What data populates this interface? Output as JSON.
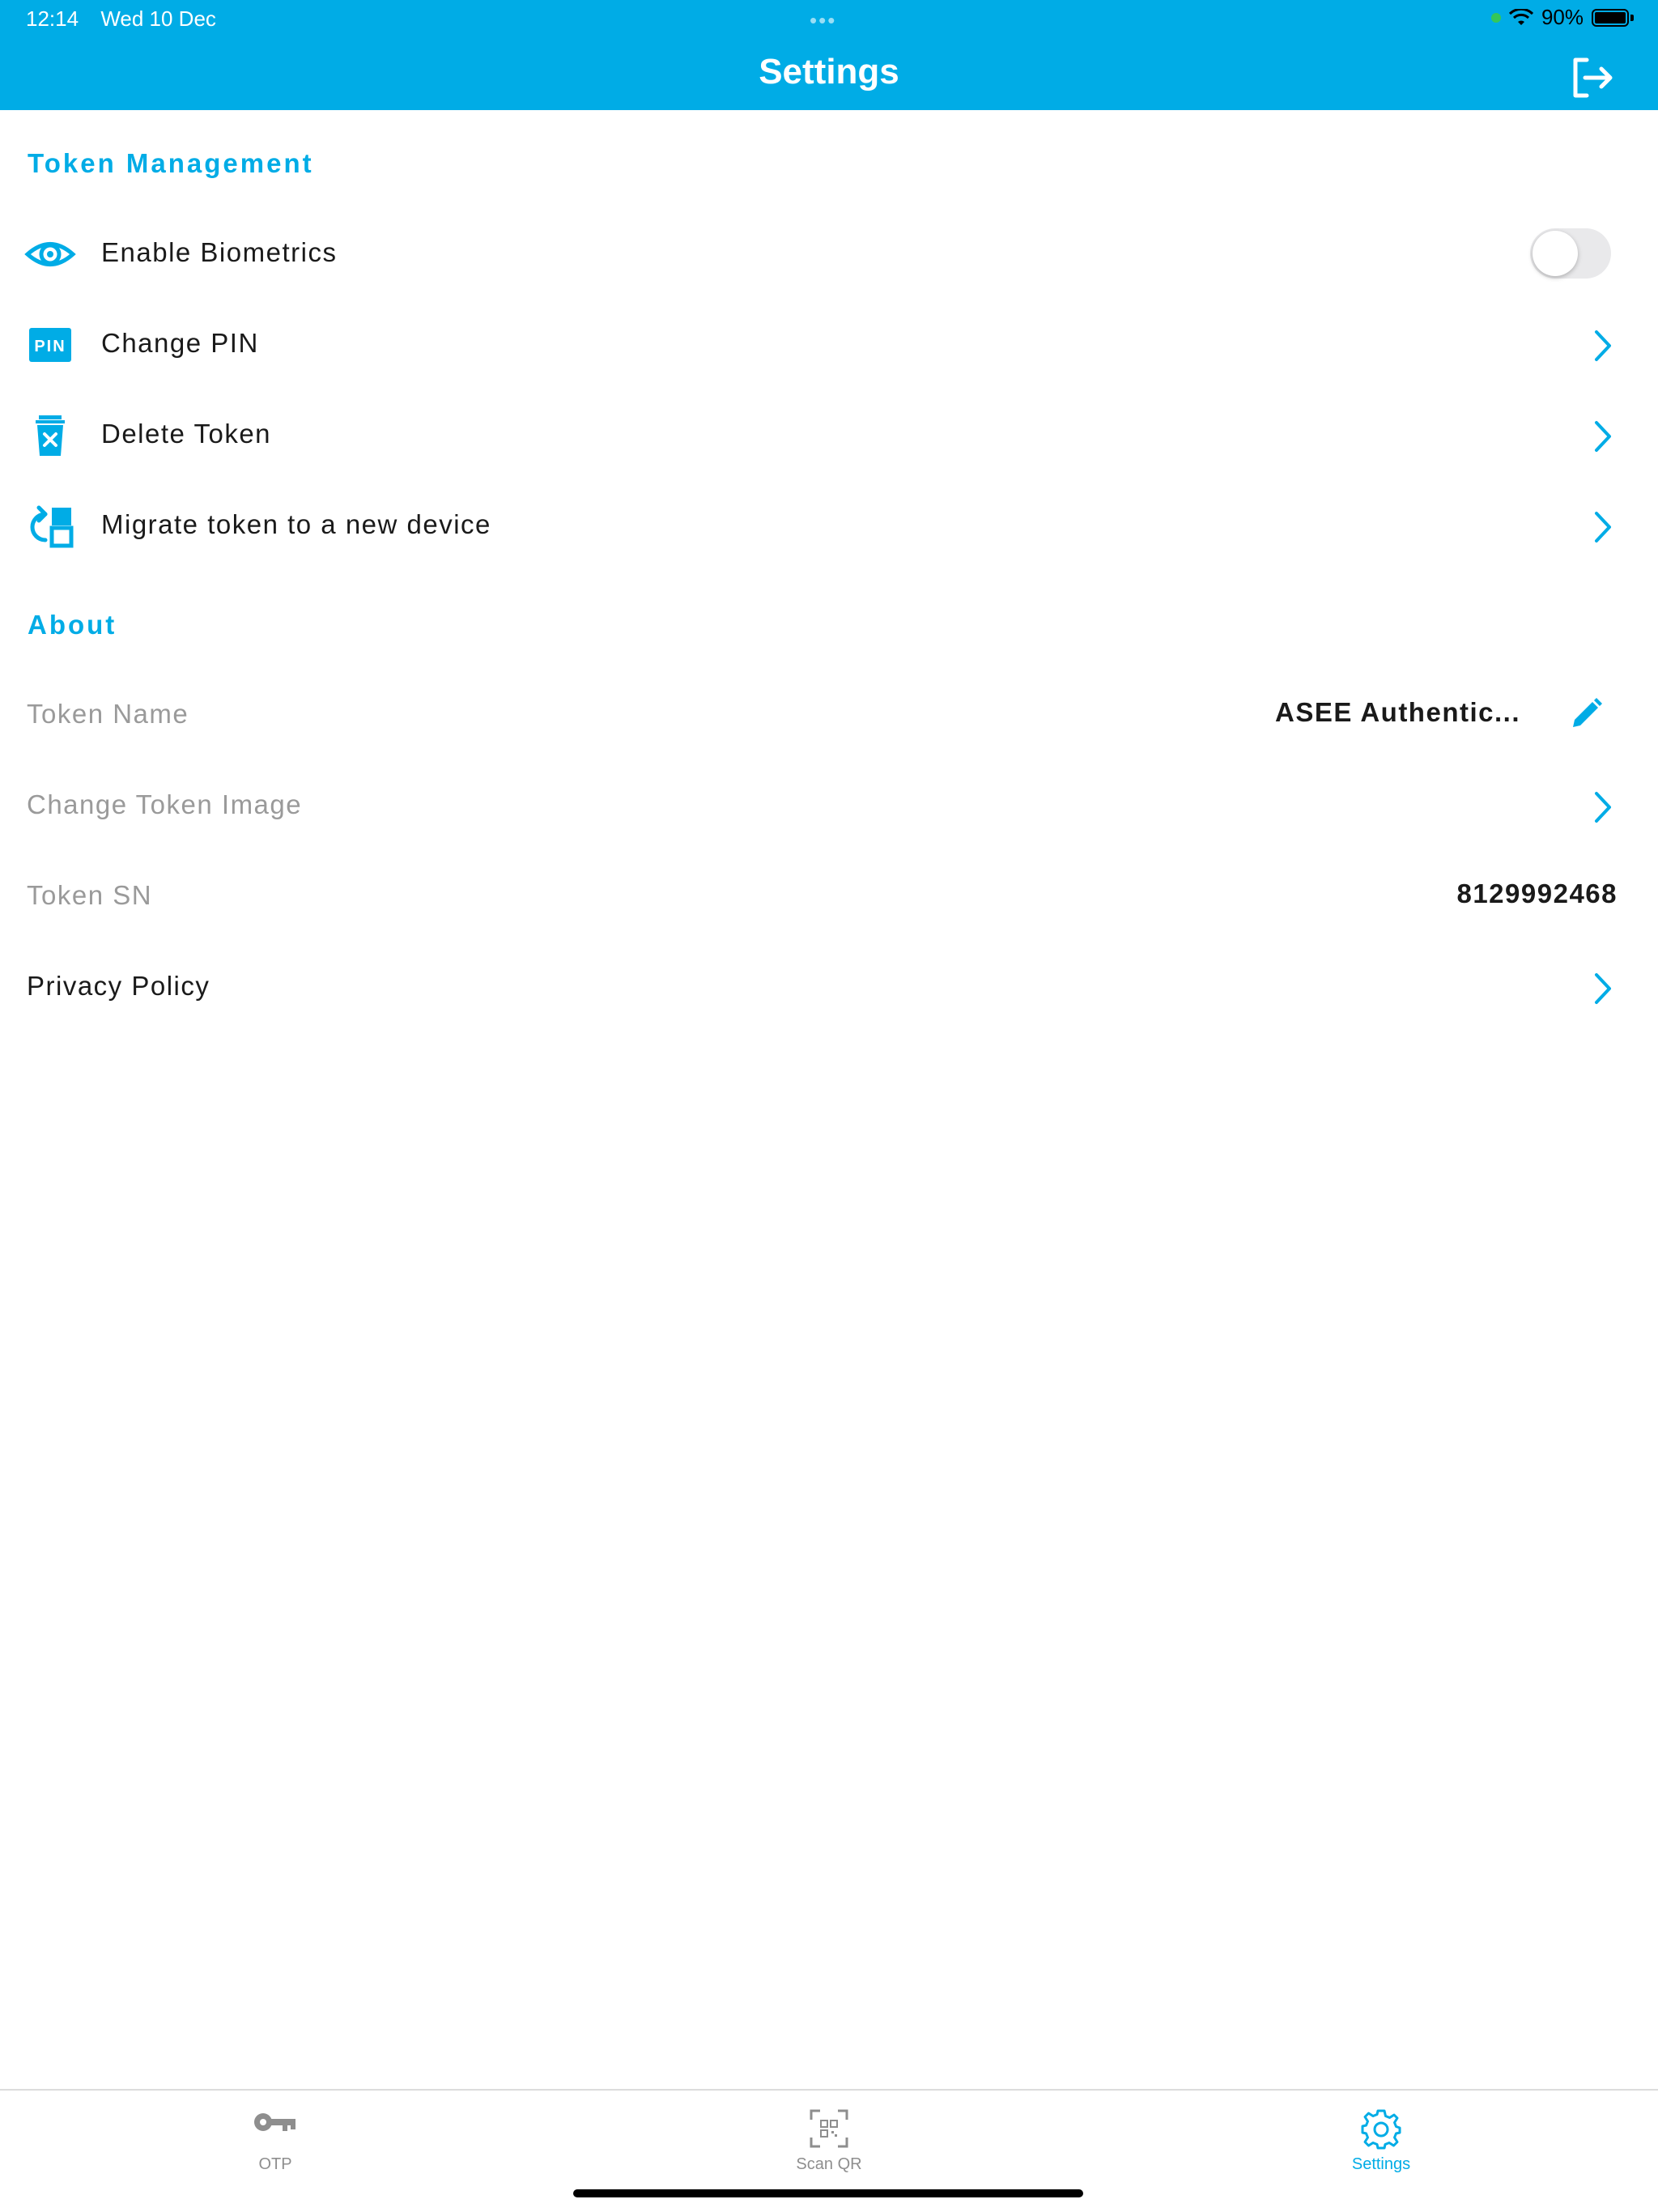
{
  "status_bar": {
    "time": "12:14",
    "date": "Wed 10 Dec",
    "dots": "•••",
    "battery": "90%"
  },
  "header": {
    "title": "Settings"
  },
  "token_management": {
    "title": "Token Management",
    "items": [
      {
        "label": "Enable Biometrics",
        "toggle_on": false
      },
      {
        "label": "Change PIN"
      },
      {
        "label": "Delete Token"
      },
      {
        "label": "Migrate token to a new device"
      }
    ]
  },
  "about": {
    "title": "About",
    "token_name": {
      "label": "Token Name",
      "value": "ASEE Authentic..."
    },
    "change_image": {
      "label": "Change Token Image"
    },
    "token_sn": {
      "label": "Token SN",
      "value": "8129992468"
    },
    "privacy": {
      "label": "Privacy Policy"
    }
  },
  "tabs": [
    {
      "label": "OTP",
      "icon": "key-icon",
      "active": false
    },
    {
      "label": "Scan QR",
      "icon": "qr-scan-icon",
      "active": false
    },
    {
      "label": "Settings",
      "icon": "gear-icon",
      "active": true
    }
  ],
  "colors": {
    "accent": "#00ACE6",
    "muted": "#9a9a9a",
    "text": "#1a1a1a"
  }
}
